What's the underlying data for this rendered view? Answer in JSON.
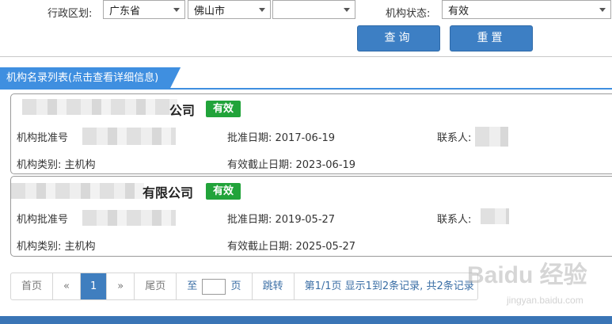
{
  "filters": {
    "region_label": "行政区划:",
    "province": "广东省",
    "city": "佛山市",
    "district": "",
    "status_label": "机构状态:",
    "status": "有效",
    "query_button": "查询",
    "reset_button": "重置"
  },
  "list": {
    "title": "机构名录列表(点击查看详细信息)",
    "items": [
      {
        "name_visible": "公司",
        "status": "有效",
        "approval_no_label": "机构批准号",
        "approval_date": "批准日期: 2017-06-19",
        "contact_label": "联系人:",
        "category": "机构类别: 主机构",
        "expiry": "有效截止日期: 2023-06-19"
      },
      {
        "name_visible": "有限公司",
        "status": "有效",
        "approval_no_label": "机构批准号",
        "approval_date": "批准日期: 2019-05-27",
        "contact_label": "联系人:",
        "category": "机构类别: 主机构",
        "expiry": "有效截止日期: 2025-05-27"
      }
    ]
  },
  "pagination": {
    "first": "首页",
    "prev": "«",
    "current": "1",
    "next": "»",
    "last": "尾页",
    "goto_prefix": "至",
    "goto_suffix": "页",
    "jump": "跳转",
    "summary": "第1/1页 显示1到2条记录, 共2条记录"
  },
  "watermark": {
    "brand": "Baidu 经验",
    "url": "jingyan.baidu.com"
  },
  "colors": {
    "accent": "#3f8fe0",
    "button": "#3d7fc4",
    "badge": "#21a33a"
  }
}
